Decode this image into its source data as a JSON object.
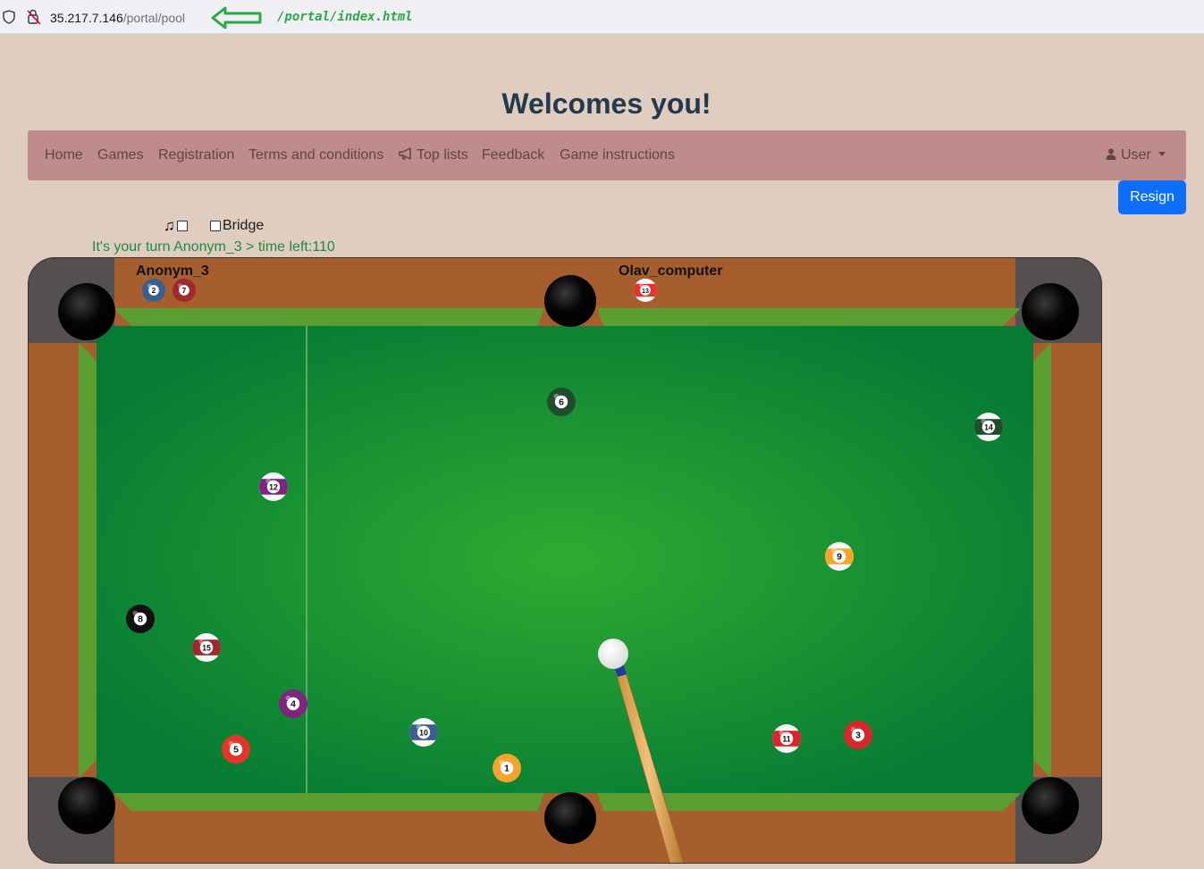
{
  "browser": {
    "url_host": "35.217.7.146",
    "url_path": "/portal/pool",
    "annotation": "/portal/index.html",
    "colors": {
      "annotation": "#2ba84a"
    }
  },
  "page": {
    "heading": "Welcomes you!"
  },
  "nav": {
    "items": [
      {
        "label": "Home"
      },
      {
        "label": "Games"
      },
      {
        "label": "Registration"
      },
      {
        "label": "Terms and conditions"
      },
      {
        "label": "Top lists",
        "icon": "megaphone-icon"
      },
      {
        "label": "Feedback"
      },
      {
        "label": "Game instructions"
      }
    ],
    "user": {
      "label": "User",
      "icon": "person-icon"
    },
    "colors": {
      "background": "#bf8c8c",
      "text": "#5f4544"
    }
  },
  "actions": {
    "resign_label": "Resign",
    "colors": {
      "resign": "#0d6efd"
    }
  },
  "controls": {
    "sound_icon": "music-note-icon",
    "sound_checked": false,
    "bridge_label": "Bridge",
    "bridge_checked": false
  },
  "status": {
    "turn_text": "It's your turn Anonym_3 > time left:110"
  },
  "game": {
    "player1": {
      "name": "Anonym_3",
      "pocketed": [
        2,
        7
      ]
    },
    "player2": {
      "name": "Olav_computer",
      "pocketed": [
        13
      ]
    },
    "balls_on_table": [
      6,
      14,
      12,
      9,
      8,
      15,
      4,
      10,
      5,
      1,
      11,
      3
    ],
    "cue_ball": "white",
    "colors": {
      "felt": "#2ca530",
      "cushion": "#5a9e32",
      "rail": "#a65e2e",
      "pocket_corner": "#555050"
    }
  }
}
